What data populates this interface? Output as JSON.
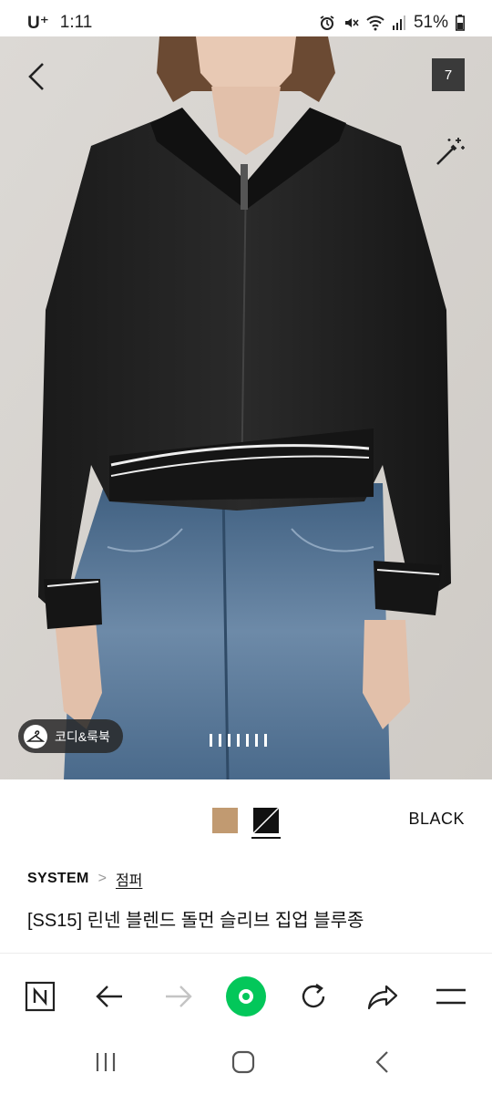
{
  "status_bar": {
    "carrier": "U⁺",
    "time": "1:11",
    "battery": "51%"
  },
  "hero": {
    "image_count": "7",
    "coordi_label": "코디&룩북",
    "page_index": 1,
    "page_total": 7
  },
  "colors": {
    "options": [
      {
        "name": "beige",
        "hex": "#c19a71"
      },
      {
        "name": "black",
        "hex": "#111111",
        "selected": true
      }
    ],
    "selected_label": "BLACK"
  },
  "product": {
    "brand": "SYSTEM",
    "separator": ">",
    "category": "점퍼",
    "title": "[SS15] 린넨 블렌드 돌먼 슬리브 집업 블루종"
  },
  "browser_toolbar": {
    "icons": [
      "naver-n-icon",
      "back-arrow-icon",
      "forward-arrow-icon",
      "green-dot-icon",
      "refresh-icon",
      "share-icon",
      "menu-icon"
    ],
    "accent": "#03c75a"
  },
  "system_nav": {
    "icons": [
      "recent-apps-icon",
      "home-icon",
      "back-icon"
    ]
  }
}
